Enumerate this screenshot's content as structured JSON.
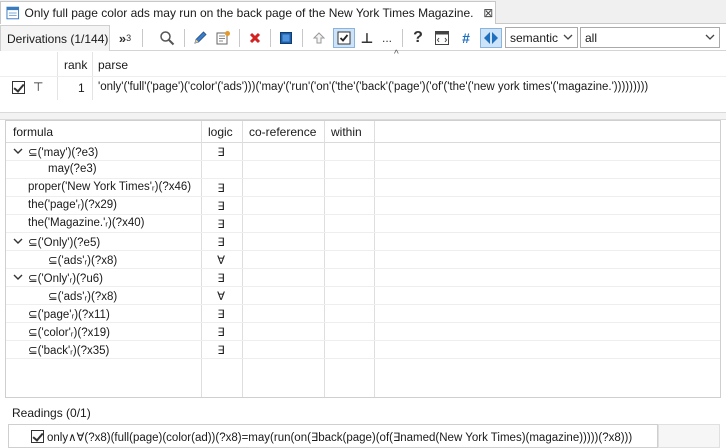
{
  "editor_tab": {
    "title": "Only full page color ads may run on the back page of the New York Times Magazine.",
    "close_glyph": "⊠"
  },
  "toolbar": {
    "derivations_tab_label": "Derivations (1/144)",
    "superscript_label": "»",
    "superscript_sub": "3",
    "turnstile_glyph": "⊥",
    "ellipsis_label": "...",
    "help_glyph": "?",
    "hash_glyph": "#",
    "mode_select_value": "semantic",
    "filter_select_value": "all",
    "accent_color": "#1f6fbf",
    "delete_color": "#d22222"
  },
  "parse_table": {
    "columns": [
      "rank",
      "parse"
    ],
    "rows": [
      {
        "checked": true,
        "marker": "⊤",
        "rank": "1",
        "parse": "'only'('full'('page')('color'('ads')))('may'('run'('on'('the'('back'('page')('of'('the'('new york times'('magazine.')))))))))"
      }
    ]
  },
  "formula_table": {
    "columns": [
      "formula",
      "logic",
      "co-reference",
      "within"
    ],
    "rows": [
      {
        "expander": "open",
        "indent": 0,
        "formula": "⊆('may')(?e3)",
        "logic": "∃"
      },
      {
        "expander": "none",
        "indent": 2,
        "formula": "may(?e3)",
        "logic": ""
      },
      {
        "expander": "none",
        "indent": 1,
        "formula": "proper('New York Times'ᵣ)(?x46)",
        "logic": "∃"
      },
      {
        "expander": "none",
        "indent": 1,
        "formula": "the('page'ᵣ)(?x29)",
        "logic": "∃"
      },
      {
        "expander": "none",
        "indent": 1,
        "formula": "the('Magazine.'ᵣ)(?x40)",
        "logic": "∃"
      },
      {
        "expander": "open",
        "indent": 0,
        "formula": "⊆('Only')(?e5)",
        "logic": "∃"
      },
      {
        "expander": "none",
        "indent": 2,
        "formula": "⊆('ads'ᵣ)(?x8)",
        "logic": "∀"
      },
      {
        "expander": "open",
        "indent": 0,
        "formula": "⊆('Only'ᵣ)(?u6)",
        "logic": "∃"
      },
      {
        "expander": "none",
        "indent": 2,
        "formula": "⊆('ads'ᵣ)(?x8)",
        "logic": "∀"
      },
      {
        "expander": "none",
        "indent": 1,
        "formula": "⊆('page'ᵣ)(?x11)",
        "logic": "∃"
      },
      {
        "expander": "none",
        "indent": 1,
        "formula": "⊆('color'ᵣ)(?x19)",
        "logic": "∃"
      },
      {
        "expander": "none",
        "indent": 1,
        "formula": "⊆('back'ᵣ)(?x35)",
        "logic": "∃"
      }
    ]
  },
  "readings": {
    "label": "Readings (0/1)",
    "items": [
      {
        "checked": true,
        "text": "only∧∀(?x8)(full(page)(color(ad))(?x8)=may(run(on(∃back(page)(of(∃named(New York Times)(magazine)))))(?x8)))"
      }
    ]
  }
}
